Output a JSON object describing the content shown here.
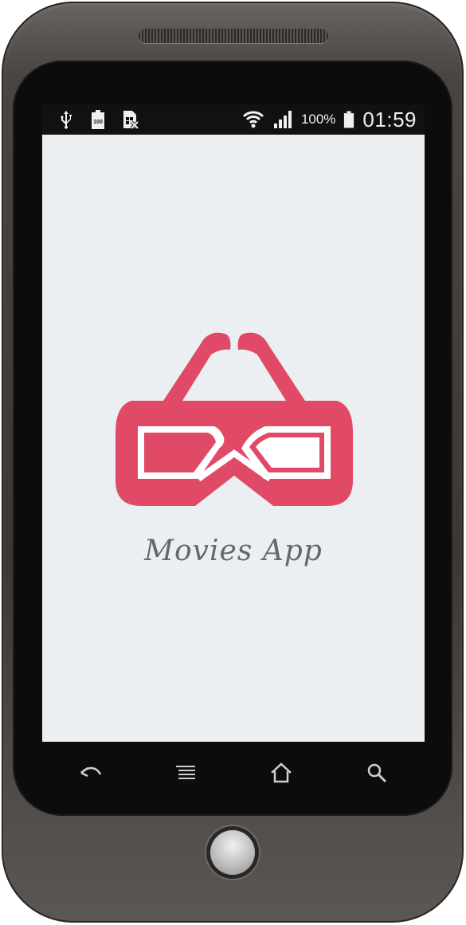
{
  "status_bar": {
    "battery_percent": "100%",
    "time": "01:59",
    "icons": [
      "usb-icon",
      "battery-100-icon",
      "sim-missing-icon",
      "wifi-icon",
      "signal-icon",
      "battery-icon"
    ]
  },
  "splash": {
    "logo_icon": "3d-glasses-icon",
    "title": "Movies App",
    "brand_color": "#e04a67",
    "background_color": "#eceff1"
  },
  "nav_bar": {
    "buttons": [
      "back-icon",
      "menu-icon",
      "home-icon",
      "search-icon"
    ]
  }
}
